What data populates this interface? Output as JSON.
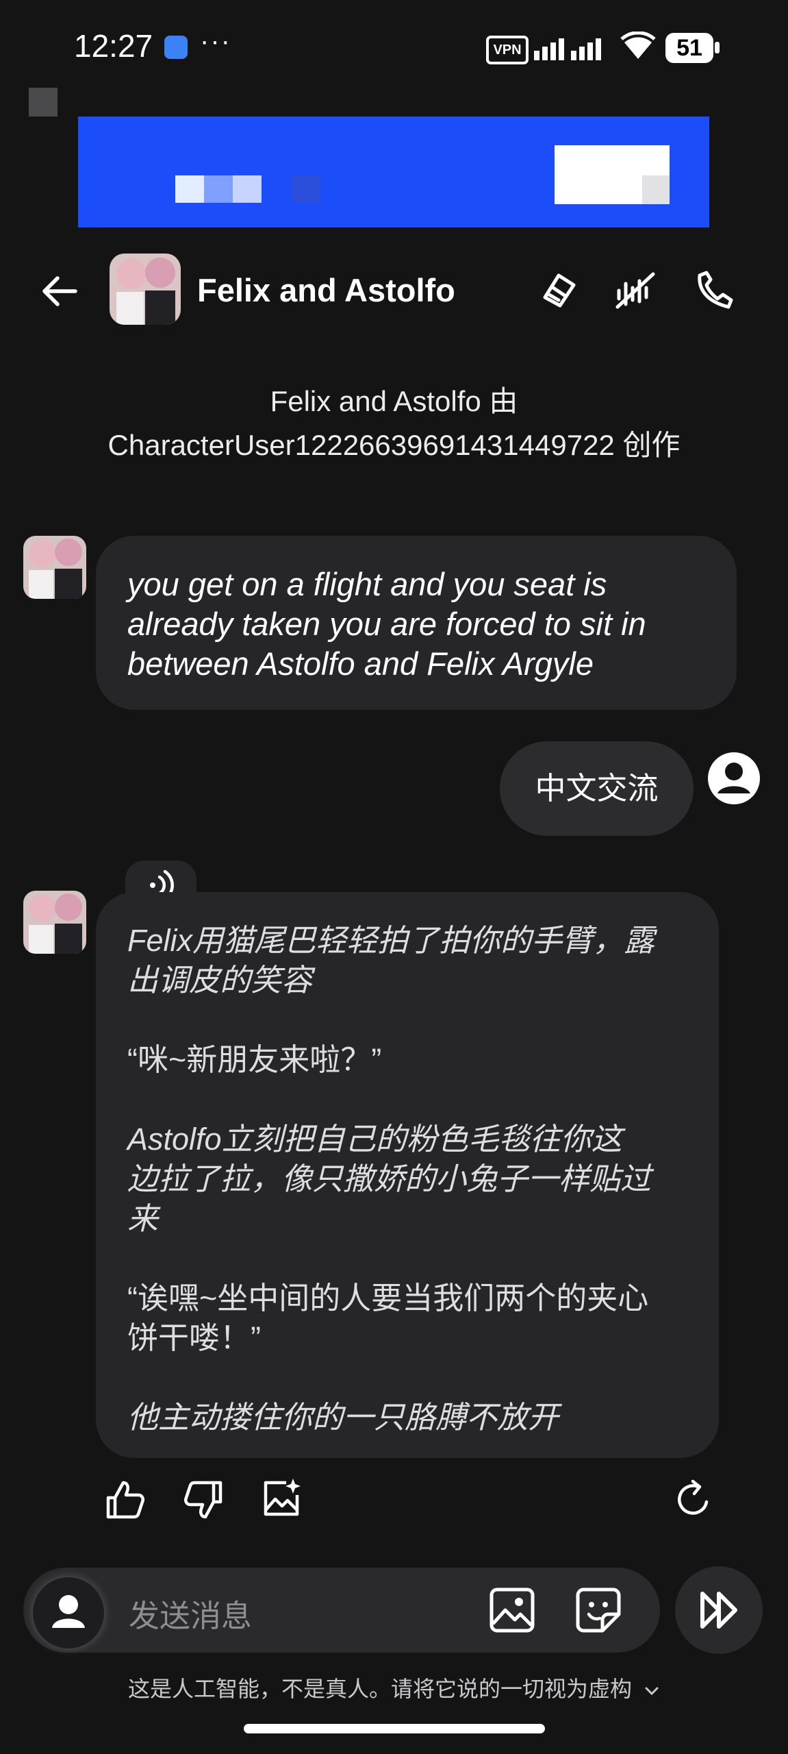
{
  "status_bar": {
    "time": "12:27",
    "dots": "···",
    "vpn": "VPN",
    "battery": "51"
  },
  "header": {
    "title": "Felix and Astolfo"
  },
  "creator_line": {
    "line1": "Felix and Astolfo 由",
    "line2": "CharacterUser12226639691431449722 创作"
  },
  "messages": [
    {
      "sender": "Felix and Astolfo",
      "lines": [
        "you get on a flight and you seat is",
        "already taken you are forced to sit in",
        "between Astolfo and Felix Argyle"
      ]
    },
    {
      "sender": "user",
      "text": "中文交流"
    },
    {
      "sender": "Felix and Astolfo",
      "paragraphs": [
        {
          "italic": true,
          "lines": [
            "Felix用猫尾巴轻轻拍了拍你的手臂，露",
            "出调皮的笑容"
          ]
        },
        {
          "italic": false,
          "lines": [
            "“咪~新朋友来啦？”"
          ]
        },
        {
          "italic": true,
          "lines": [
            "Astolfo立刻把自己的粉色毛毯往你这",
            "边拉了拉，像只撒娇的小兔子一样贴过",
            "来"
          ]
        },
        {
          "italic": false,
          "lines": [
            "“诶嘿~坐中间的人要当我们两个的夹心",
            "饼干喽！”"
          ]
        },
        {
          "italic": true,
          "lines": [
            "他主动搂住你的一只胳膊不放开"
          ]
        }
      ]
    }
  ],
  "input": {
    "placeholder": "发送消息"
  },
  "disclaimer": "这是人工智能，不是真人。请将它说的一切视为虚构",
  "icons": {
    "header": [
      "back-arrow-icon",
      "brush-icon",
      "voice-off-icon",
      "phone-call-icon"
    ],
    "actions": [
      "thumbs-up-icon",
      "thumbs-down-icon",
      "image-sparkle-icon",
      "regenerate-icon"
    ],
    "input": [
      "user-avatar-icon",
      "image-icon",
      "sticker-icon",
      "fast-forward-icon"
    ]
  },
  "colors": {
    "background": "#141415",
    "bubble": "#262628",
    "banner": "#1b4ef8"
  }
}
